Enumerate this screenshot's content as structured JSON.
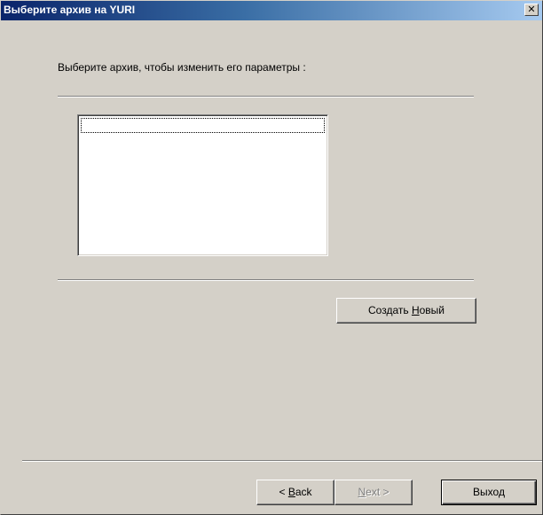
{
  "window": {
    "title": "Выберите архив на YURI",
    "close_label": "✕"
  },
  "main": {
    "instruction": "Выберите архив, чтобы изменить его параметры :",
    "archive_list": []
  },
  "buttons": {
    "create_new_pre": "Создать ",
    "create_new_mnemonic": "Н",
    "create_new_post": "овый",
    "back_pre": "< ",
    "back_mnemonic": "B",
    "back_post": "ack",
    "next_mnemonic": "N",
    "next_post": "ext >",
    "exit": "Выход"
  }
}
